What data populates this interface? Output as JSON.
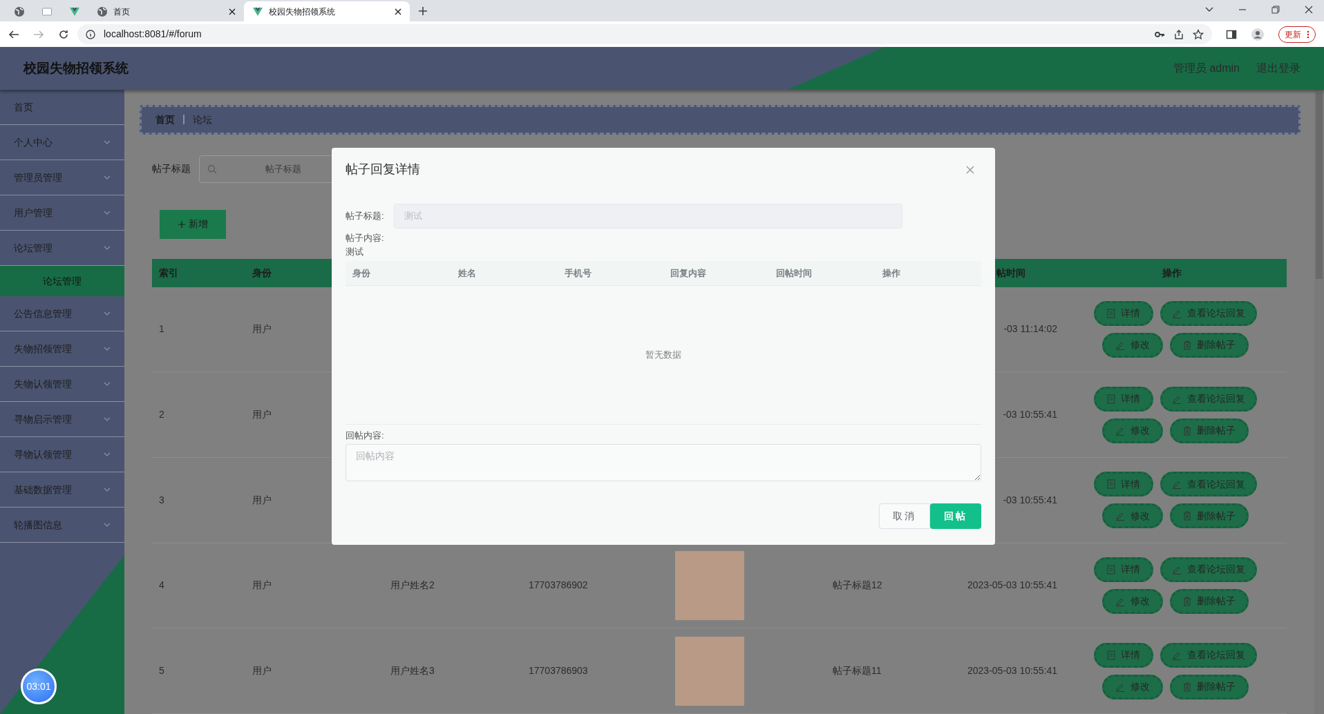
{
  "browser": {
    "tabs": [
      {
        "selected": false
      },
      {
        "selected": false
      },
      {
        "selected": false
      },
      {
        "title": "首页",
        "selected": false
      },
      {
        "title": "校园失物招领系统",
        "selected": true
      }
    ],
    "url": "localhost:8081/#/forum",
    "update_button": "更新"
  },
  "header": {
    "title": "校园失物招领系统",
    "user": "管理员 admin",
    "logout": "退出登录"
  },
  "sidebar": {
    "items": [
      {
        "label": "首页",
        "kind": "link"
      },
      {
        "label": "个人中心",
        "kind": "menu"
      },
      {
        "label": "管理员管理",
        "kind": "menu"
      },
      {
        "label": "用户管理",
        "kind": "menu"
      },
      {
        "label": "论坛管理",
        "kind": "menu",
        "children": [
          {
            "label": "论坛管理",
            "selected": true
          }
        ]
      },
      {
        "label": "公告信息管理",
        "kind": "menu"
      },
      {
        "label": "失物招领管理",
        "kind": "menu"
      },
      {
        "label": "失物认领管理",
        "kind": "menu"
      },
      {
        "label": "寻物启示管理",
        "kind": "menu"
      },
      {
        "label": "寻物认领管理",
        "kind": "menu"
      },
      {
        "label": "基础数据管理",
        "kind": "menu"
      },
      {
        "label": "轮播图信息",
        "kind": "menu"
      }
    ]
  },
  "breadcrumb": [
    "首页",
    "论坛"
  ],
  "search": {
    "label": "帖子标题",
    "placeholder": "帖子标题"
  },
  "add_button": "新增",
  "table": {
    "columns": {
      "index": "索引",
      "identity": "身份",
      "time": "帖时间",
      "actions": "操作"
    },
    "rows": [
      {
        "index": "1",
        "identity": "用户",
        "time": "-03 11:14:02",
        "actions": [
          "详情",
          "查看论坛回复",
          "修改",
          "删除帖子"
        ]
      },
      {
        "index": "2",
        "identity": "用户",
        "time": "-03 10:55:41",
        "actions": [
          "详情",
          "查看论坛回复",
          "修改",
          "删除帖子"
        ]
      },
      {
        "index": "3",
        "identity": "用户",
        "time": "-03 10:55:41",
        "actions": [
          "详情",
          "查看论坛回复",
          "修改",
          "删除帖子"
        ]
      },
      {
        "index": "4",
        "identity": "用户",
        "name": "用户姓名2",
        "phone": "17703786902",
        "photo": true,
        "title": "帖子标题12",
        "time": "2023-05-03 10:55:41",
        "actions": [
          "详情",
          "查看论坛回复",
          "修改",
          "删除帖子"
        ]
      },
      {
        "index": "5",
        "identity": "用户",
        "name": "用户姓名3",
        "phone": "17703786903",
        "photo": true,
        "title": "帖子标题11",
        "time": "2023-05-03 10:55:41",
        "actions": [
          "详情",
          "查看论坛回复",
          "修改",
          "删除帖子"
        ]
      }
    ]
  },
  "dialog": {
    "title": "帖子回复详情",
    "title_label": "帖子标题:",
    "title_value": "测试",
    "content_label": "帖子内容:",
    "content_value": "测试",
    "reply_columns": [
      "身份",
      "姓名",
      "手机号",
      "回复内容",
      "回帖时间",
      "操作"
    ],
    "empty_text": "暂无数据",
    "reply_label": "回帖内容:",
    "reply_placeholder": "回帖内容",
    "cancel": "取消",
    "submit": "回帖"
  },
  "timer": "03:01"
}
